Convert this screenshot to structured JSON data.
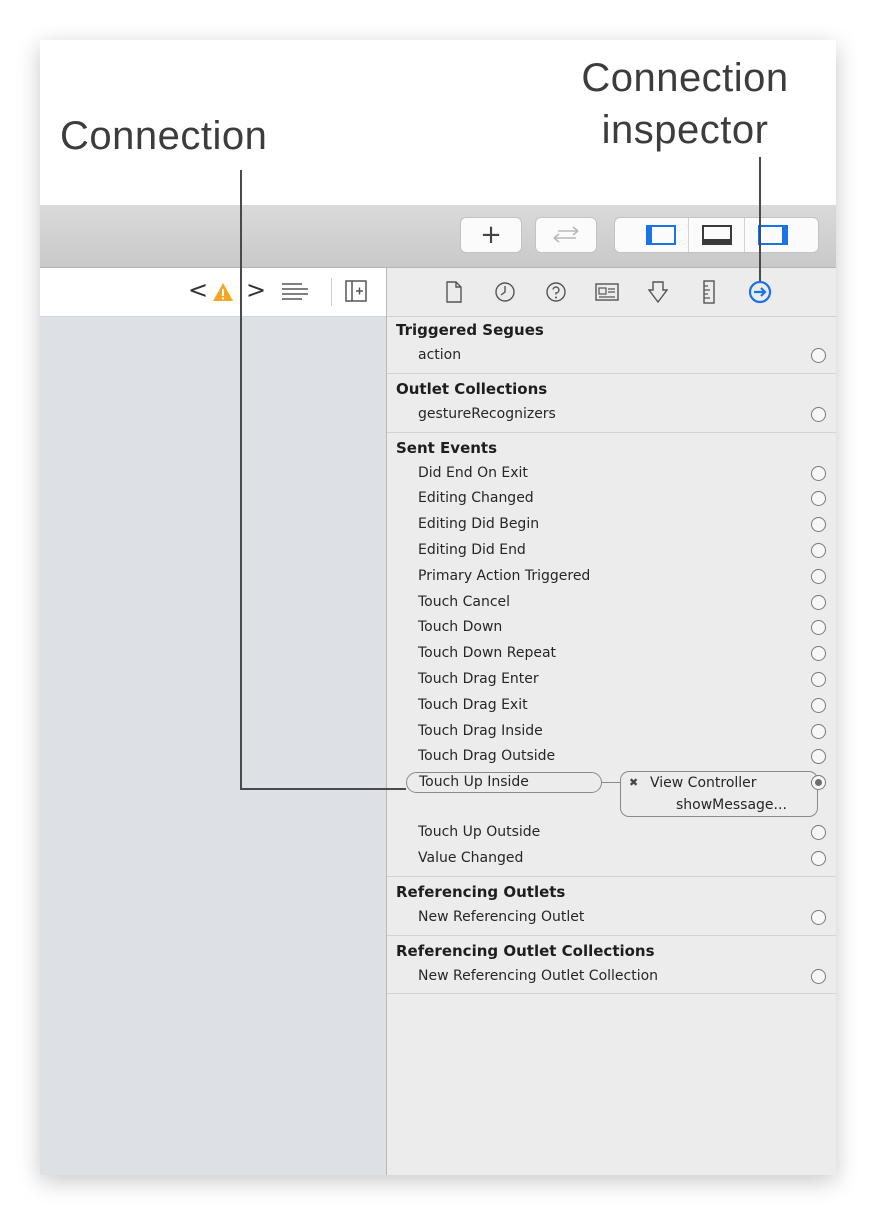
{
  "callouts": {
    "connection": "Connection",
    "inspector_line1": "Connection",
    "inspector_line2": "inspector"
  },
  "toolbar": {
    "add_label": "+",
    "buttons": [
      "plus-icon",
      "back-forward-arrows-icon",
      "navigator-toggle-icon",
      "debug-area-toggle-icon",
      "inspector-toggle-icon"
    ]
  },
  "jumpbar": {
    "prev": "<",
    "next": ">",
    "icons": [
      "warning-icon",
      "lines-icon",
      "add-editor-icon"
    ]
  },
  "inspector": {
    "tabs": [
      "file-icon",
      "history-icon",
      "help-icon",
      "identity-icon",
      "attributes-icon",
      "size-icon",
      "connections-icon"
    ],
    "active_tab": "connections-icon",
    "accent_color": "#1a73e8",
    "sections": {
      "triggered_segues": {
        "title": "Triggered Segues",
        "rows": [
          "action"
        ]
      },
      "outlet_collections": {
        "title": "Outlet Collections",
        "rows": [
          "gestureRecognizers"
        ]
      },
      "sent_events": {
        "title": "Sent Events",
        "rows": [
          "Did End On Exit",
          "Editing Changed",
          "Editing Did Begin",
          "Editing Did End",
          "Primary Action Triggered",
          "Touch Cancel",
          "Touch Down",
          "Touch Down Repeat",
          "Touch Drag Enter",
          "Touch Drag Exit",
          "Touch Drag Inside",
          "Touch Drag Outside"
        ],
        "connected": {
          "event": "Touch Up Inside",
          "remove_symbol": "✖",
          "target": "View Controller",
          "method": "showMessage..."
        },
        "rows_after": [
          "Touch Up Outside",
          "Value Changed"
        ]
      },
      "referencing_outlets": {
        "title": "Referencing Outlets",
        "rows": [
          "New Referencing Outlet"
        ]
      },
      "referencing_outlet_collections": {
        "title": "Referencing Outlet Collections",
        "rows": [
          "New Referencing Outlet Collection"
        ]
      }
    }
  }
}
